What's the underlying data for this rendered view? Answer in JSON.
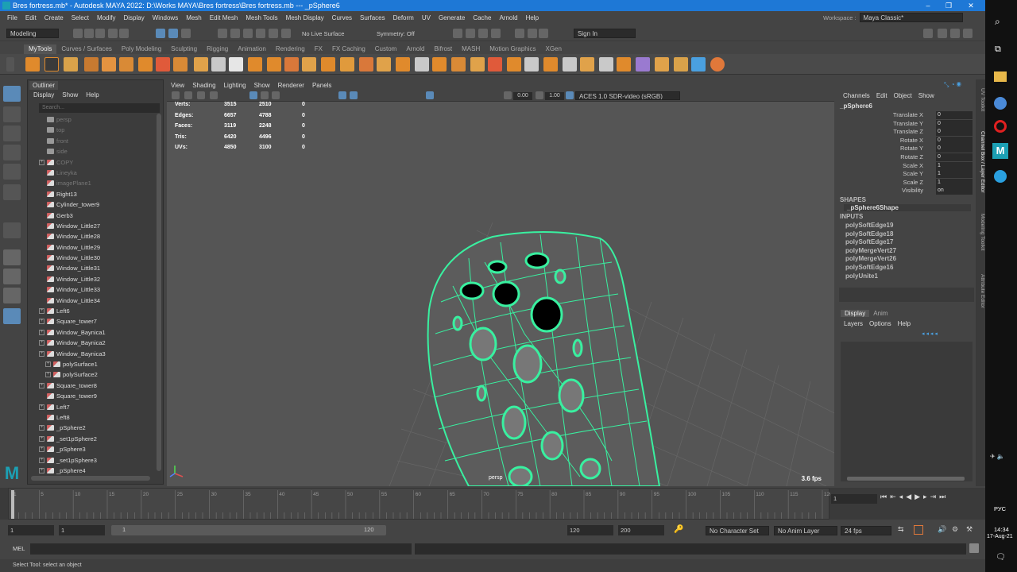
{
  "title": "Bres fortress.mb* - Autodesk MAYA 2022: D:\\Works MAYA\\Bres fortress\\Bres fortress.mb  ---  _pSphere6",
  "menu": [
    "File",
    "Edit",
    "Create",
    "Select",
    "Modify",
    "Display",
    "Windows",
    "Mesh",
    "Edit Mesh",
    "Mesh Tools",
    "Mesh Display",
    "Curves",
    "Surfaces",
    "Deform",
    "UV",
    "Generate",
    "Cache",
    "Arnold",
    "Help"
  ],
  "workspace": {
    "label": "Workspace :",
    "value": "Maya Classic*"
  },
  "status": {
    "menuset": "Modeling",
    "live_surface": "No Live Surface",
    "symmetry": "Symmetry: Off",
    "sign_in": "Sign In"
  },
  "shelf_tabs": [
    "MyTools",
    "Curves / Surfaces",
    "Poly Modeling",
    "Sculpting",
    "Rigging",
    "Animation",
    "Rendering",
    "FX",
    "FX Caching",
    "Custom",
    "Arnold",
    "Bifrost",
    "MASH",
    "Motion Graphics",
    "XGen"
  ],
  "outliner": {
    "tab": "Outliner",
    "menu": [
      "Display",
      "Show",
      "Help"
    ],
    "search": "Search...",
    "rows": [
      {
        "name": "persp",
        "dim": true,
        "exp": false,
        "indent": 0,
        "cam": true
      },
      {
        "name": "top",
        "dim": true,
        "exp": false,
        "indent": 0,
        "cam": true
      },
      {
        "name": "front",
        "dim": true,
        "exp": false,
        "indent": 0,
        "cam": true
      },
      {
        "name": "side",
        "dim": true,
        "exp": false,
        "indent": 0,
        "cam": true
      },
      {
        "name": "COPY",
        "dim": true,
        "exp": true,
        "indent": 0
      },
      {
        "name": "Lineyka",
        "dim": true,
        "exp": false,
        "indent": 0
      },
      {
        "name": "imagePlane1",
        "dim": true,
        "exp": false,
        "indent": 0
      },
      {
        "name": "Right13",
        "dim": false,
        "exp": false,
        "indent": 0
      },
      {
        "name": "Cylinder_tower9",
        "dim": false,
        "exp": false,
        "indent": 0
      },
      {
        "name": "Gerb3",
        "dim": false,
        "exp": false,
        "indent": 0
      },
      {
        "name": "Window_Little27",
        "dim": false,
        "exp": false,
        "indent": 0
      },
      {
        "name": "Window_Little28",
        "dim": false,
        "exp": false,
        "indent": 0
      },
      {
        "name": "Window_Little29",
        "dim": false,
        "exp": false,
        "indent": 0
      },
      {
        "name": "Window_Little30",
        "dim": false,
        "exp": false,
        "indent": 0
      },
      {
        "name": "Window_Little31",
        "dim": false,
        "exp": false,
        "indent": 0
      },
      {
        "name": "Window_Little32",
        "dim": false,
        "exp": false,
        "indent": 0
      },
      {
        "name": "Window_Little33",
        "dim": false,
        "exp": false,
        "indent": 0
      },
      {
        "name": "Window_Little34",
        "dim": false,
        "exp": false,
        "indent": 0
      },
      {
        "name": "Left6",
        "dim": false,
        "exp": true,
        "indent": 0
      },
      {
        "name": "Square_tower7",
        "dim": false,
        "exp": true,
        "indent": 0
      },
      {
        "name": "Window_Baynica1",
        "dim": false,
        "exp": true,
        "indent": 0
      },
      {
        "name": "Window_Baynica2",
        "dim": false,
        "exp": true,
        "indent": 0
      },
      {
        "name": "Window_Baynica3",
        "dim": false,
        "exp": true,
        "indent": 0
      },
      {
        "name": "polySurface1",
        "dim": false,
        "exp": true,
        "indent": 1
      },
      {
        "name": "polySurface2",
        "dim": false,
        "exp": true,
        "indent": 1
      },
      {
        "name": "Square_tower8",
        "dim": false,
        "exp": true,
        "indent": 0
      },
      {
        "name": "Square_tower9",
        "dim": false,
        "exp": false,
        "indent": 0
      },
      {
        "name": "Left7",
        "dim": false,
        "exp": true,
        "indent": 0
      },
      {
        "name": "Left8",
        "dim": false,
        "exp": false,
        "indent": 0
      },
      {
        "name": "_pSphere2",
        "dim": false,
        "exp": true,
        "indent": 0
      },
      {
        "name": "_set1pSphere2",
        "dim": false,
        "exp": true,
        "indent": 0
      },
      {
        "name": "_pSphere3",
        "dim": false,
        "exp": true,
        "indent": 0
      },
      {
        "name": "_set1pSphere3",
        "dim": false,
        "exp": true,
        "indent": 0
      },
      {
        "name": "_pSphere4",
        "dim": false,
        "exp": true,
        "indent": 0
      }
    ]
  },
  "viewport": {
    "menu": [
      "View",
      "Shading",
      "Lighting",
      "Show",
      "Renderer",
      "Panels"
    ],
    "exposure": "0.00",
    "gamma": "1.00",
    "colorspace": "ACES 1.0 SDR-video (sRGB)",
    "camera": "persp",
    "fps": "3.6 fps",
    "stats": [
      {
        "label": "Verts:",
        "a": "3515",
        "b": "2510",
        "c": "0"
      },
      {
        "label": "Edges:",
        "a": "6657",
        "b": "4788",
        "c": "0"
      },
      {
        "label": "Faces:",
        "a": "3119",
        "b": "2248",
        "c": "0"
      },
      {
        "label": "Tris:",
        "a": "6420",
        "b": "4496",
        "c": "0"
      },
      {
        "label": "UVs:",
        "a": "4850",
        "b": "3100",
        "c": "0"
      }
    ]
  },
  "channels": {
    "menu": [
      "Channels",
      "Edit",
      "Object",
      "Show"
    ],
    "object": "_pSphere6",
    "attrs": [
      {
        "name": "Translate X",
        "value": "0"
      },
      {
        "name": "Translate Y",
        "value": "0"
      },
      {
        "name": "Translate Z",
        "value": "0"
      },
      {
        "name": "Rotate X",
        "value": "0"
      },
      {
        "name": "Rotate Y",
        "value": "0"
      },
      {
        "name": "Rotate Z",
        "value": "0"
      },
      {
        "name": "Scale X",
        "value": "1"
      },
      {
        "name": "Scale Y",
        "value": "1"
      },
      {
        "name": "Scale Z",
        "value": "1"
      },
      {
        "name": "Visibility",
        "value": "on"
      }
    ],
    "shapes_label": "SHAPES",
    "shape": "_pSphere6Shape",
    "inputs_label": "INPUTS",
    "inputs": [
      "polySoftEdge19",
      "polySoftEdge18",
      "polySoftEdge17",
      "polyMergeVert27",
      "polyMergeVert26",
      "polySoftEdge16",
      "polyUnite1"
    ]
  },
  "layers": {
    "tabs": [
      "Display",
      "Anim"
    ],
    "menu": [
      "Layers",
      "Options",
      "Help"
    ]
  },
  "side_tabs": [
    "UV Toolkit",
    "Channel Box / Layer Editor",
    "Modeling Toolkit",
    "Attribute Editor"
  ],
  "timeline": {
    "ticks": [
      "1",
      "5",
      "10",
      "15",
      "20",
      "25",
      "30",
      "35",
      "40",
      "45",
      "50",
      "55",
      "60",
      "65",
      "70",
      "75",
      "80",
      "85",
      "90",
      "95",
      "100",
      "105",
      "110",
      "115",
      "120"
    ],
    "current": "1"
  },
  "range": {
    "start": "1",
    "playstart": "1",
    "range_start": "1",
    "range_end": "120",
    "playend": "120",
    "end": "200",
    "character": "No Character Set",
    "anim_layer": "No Anim Layer",
    "fps": "24 fps"
  },
  "cmd": {
    "label": "MEL"
  },
  "help": "Select Tool: select an object",
  "taskbar": {
    "lang": "РУС",
    "time": "14:34",
    "date": "17-Aug-21"
  },
  "colors": {
    "wire": "#39f0a0",
    "title_bar": "#1e78d6"
  }
}
